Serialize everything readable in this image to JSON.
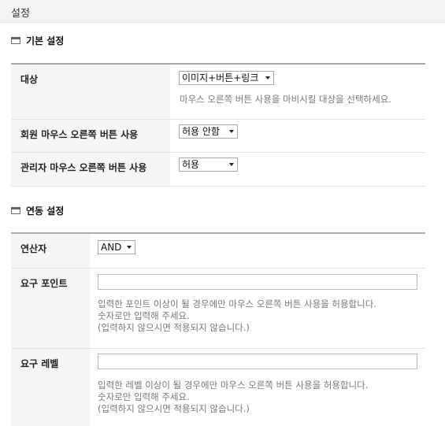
{
  "page": {
    "title": "설정"
  },
  "basic": {
    "heading": "기본 설정",
    "target": {
      "label": "대상",
      "value": "이미지+버튼+링크",
      "help": "마우스 오른쪽 버튼 사용을 마비시킬 대상을 선택하세요."
    },
    "member": {
      "label": "회원 마우스 오른쪽 버튼 사용",
      "value": "허용 안함"
    },
    "admin": {
      "label": "관리자 마우스 오른쪽 버튼 사용",
      "value": "허용"
    }
  },
  "linked": {
    "heading": "연동 설정",
    "operator": {
      "label": "연산자",
      "value": "AND"
    },
    "required_point": {
      "label": "요구 포인트",
      "value": "",
      "help_1": "입력한 포인트 이상이 될 경우에만 마우스 오른쪽 버튼 사용을 허용합니다.",
      "help_2": "숫자로만 입력해 주세요.",
      "help_3": "(입력하지 않으시면 적용되지 않습니다.)"
    },
    "required_level": {
      "label": "요구 레벨",
      "value": "",
      "help_1": "입력한 레벨 이상이 될 경우에만 마우스 오른쪽 버튼 사용을 허용합니다.",
      "help_2": "숫자로만 입력해 주세요.",
      "help_3": "(입력하지 않으시면 적용되지 않습니다.)"
    }
  }
}
